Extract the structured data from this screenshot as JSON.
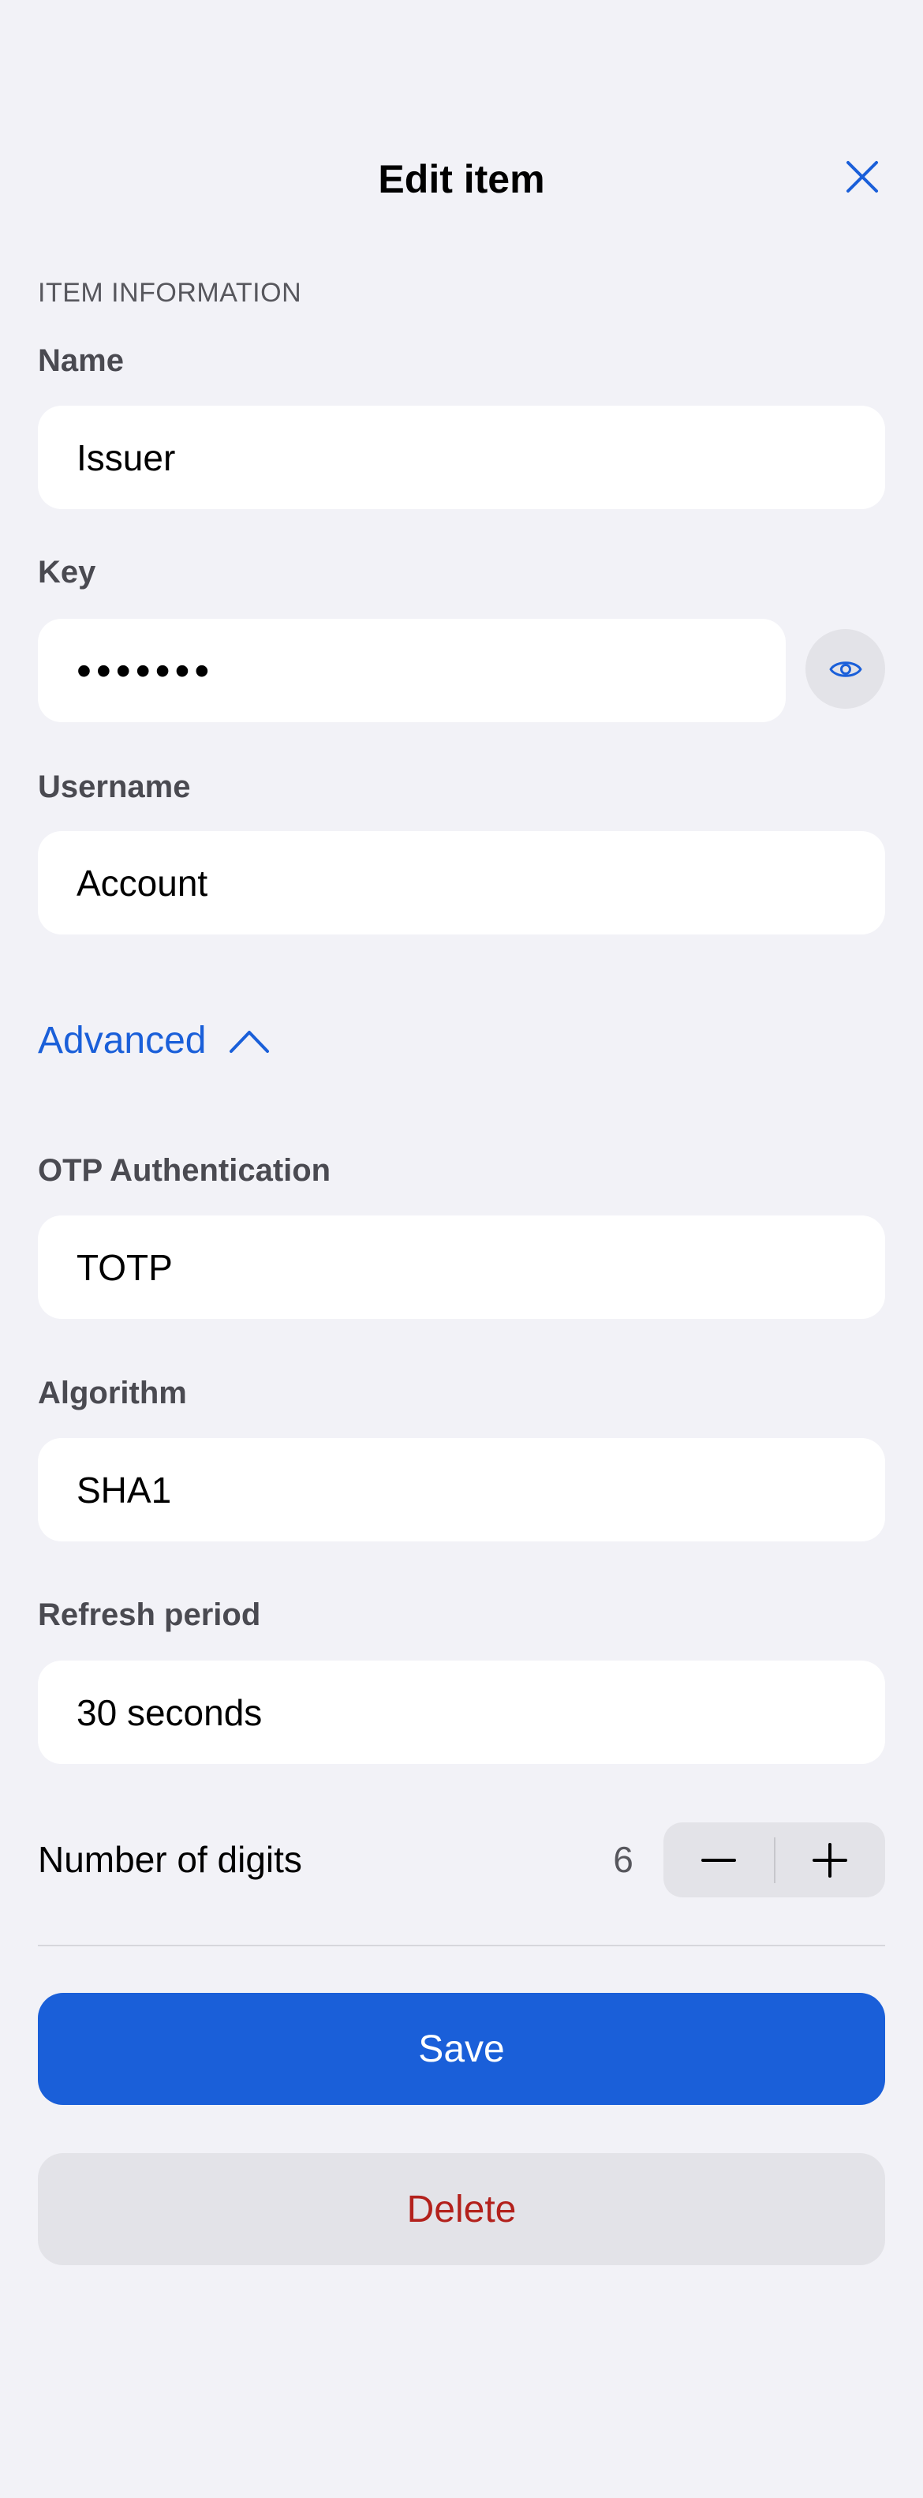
{
  "header": {
    "title": "Edit item",
    "close_icon": "close-icon"
  },
  "section": {
    "title": "ITEM INFORMATION"
  },
  "fields": {
    "name": {
      "label": "Name",
      "value": "Issuer"
    },
    "key": {
      "label": "Key",
      "value": "•••••••",
      "reveal_icon": "eye-icon"
    },
    "username": {
      "label": "Username",
      "value": "Account"
    }
  },
  "advanced": {
    "label": "Advanced",
    "expanded": true,
    "chevron_icon": "chevron-up-icon"
  },
  "otp": {
    "auth": {
      "label": "OTP Authentication",
      "value": "TOTP"
    },
    "algorithm": {
      "label": "Algorithm",
      "value": "SHA1"
    },
    "period": {
      "label": "Refresh period",
      "value": "30 seconds"
    },
    "digits": {
      "label": "Number of digits",
      "value": "6",
      "decrement_icon": "minus-icon",
      "increment_icon": "plus-icon"
    }
  },
  "actions": {
    "save_label": "Save",
    "delete_label": "Delete"
  },
  "colors": {
    "background": "#f2f2f7",
    "accent": "#1a5fd9",
    "destructive": "#b3211c",
    "field_background": "#ffffff",
    "secondary_fill": "#e3e3e8"
  }
}
